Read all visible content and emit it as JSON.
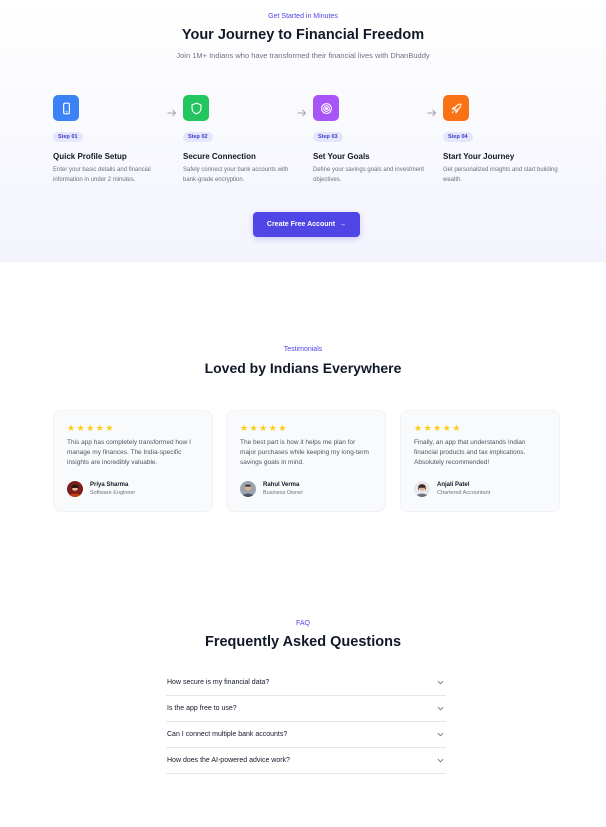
{
  "hero": {
    "eyebrow": "Get Started in Minutes",
    "title": "Your Journey to Financial Freedom",
    "subtitle": "Join 1M+ Indians who have transformed their financial lives with DhanBuddy"
  },
  "steps": [
    {
      "pill": "Step 01",
      "title": "Quick Profile Setup",
      "desc": "Enter your basic details and financial information in under 2 minutes.",
      "icon": "phone-icon",
      "color": "#3b82f6"
    },
    {
      "pill": "Step 02",
      "title": "Secure Connection",
      "desc": "Safely connect your bank accounts with bank-grade encryption.",
      "icon": "shield-icon",
      "color": "#22c55e"
    },
    {
      "pill": "Step 03",
      "title": "Set Your Goals",
      "desc": "Define your savings goals and investment objectives.",
      "icon": "target-icon",
      "color": "#a855f7"
    },
    {
      "pill": "Step 04",
      "title": "Start Your Journey",
      "desc": "Get personalized insights and start building wealth.",
      "icon": "rocket-icon",
      "color": "#f97316"
    }
  ],
  "cta": {
    "label": "Create Free Account",
    "arrow": "→"
  },
  "testimonials": {
    "eyebrow": "Testimonials",
    "title": "Loved by Indians Everywhere",
    "rating": 5,
    "items": [
      {
        "quote": "This app has completely transformed how I manage my finances. The India-specific insights are incredibly valuable.",
        "name": "Priya Sharma",
        "role": "Software Engineer"
      },
      {
        "quote": "The best part is how it helps me plan for major purchases while keeping my long-term savings goals in mind.",
        "name": "Rahul Verma",
        "role": "Business Owner"
      },
      {
        "quote": "Finally, an app that understands Indian financial products and tax implications. Absolutely recommended!",
        "name": "Anjali Patel",
        "role": "Chartered Accountant"
      }
    ]
  },
  "faq": {
    "eyebrow": "FAQ",
    "title": "Frequently Asked Questions",
    "items": [
      {
        "question": "How secure is my financial data?"
      },
      {
        "question": "Is the app free to use?"
      },
      {
        "question": "Can I connect multiple bank accounts?"
      },
      {
        "question": "How does the AI-powered advice work?"
      }
    ]
  },
  "colors": {
    "accent": "#4f46e5",
    "star": "#facc15"
  }
}
